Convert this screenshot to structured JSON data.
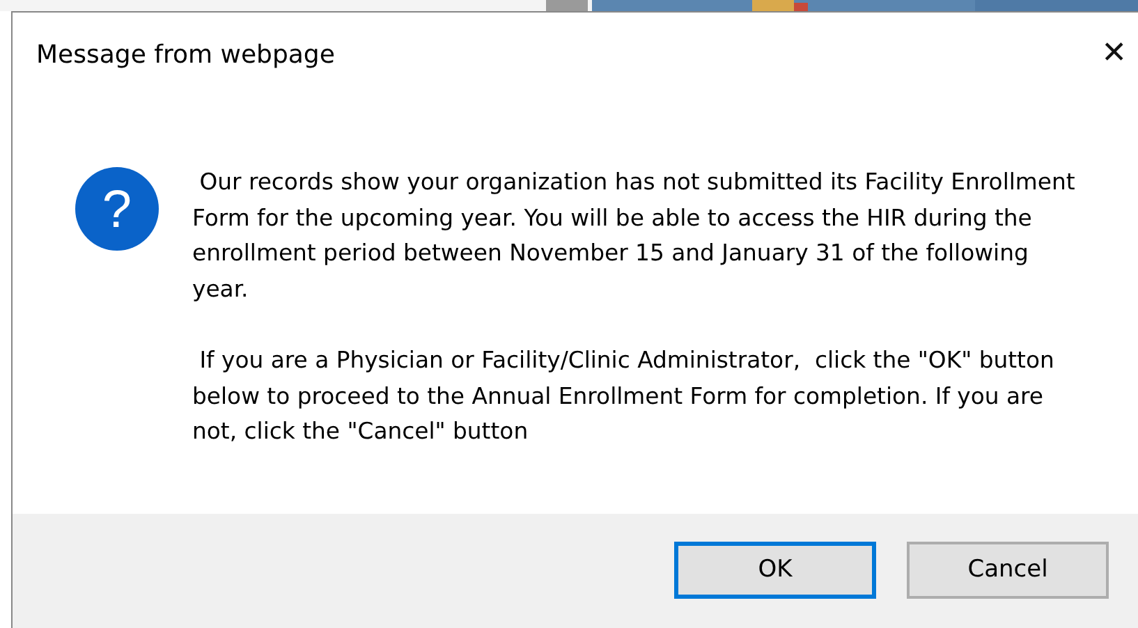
{
  "window": {
    "title": "Message from webpage",
    "close": "✕"
  },
  "message": {
    "icon": "?",
    "paragraphs": [
      " Our records show your organization has not submitted its Facility Enrollment Form for the upcoming year. You will be able to access the HIR during the enrollment period between November 15 and January 31 of the following year.",
      " If you are a Physician or Facility/Clinic Administrator,  click the \"OK\" button below to proceed to the Annual Enrollment Form for completion. If you are not, click the \"Cancel\" button"
    ]
  },
  "buttons": [
    {
      "label": "OK",
      "default": true
    },
    {
      "label": "Cancel",
      "default": false
    }
  ]
}
